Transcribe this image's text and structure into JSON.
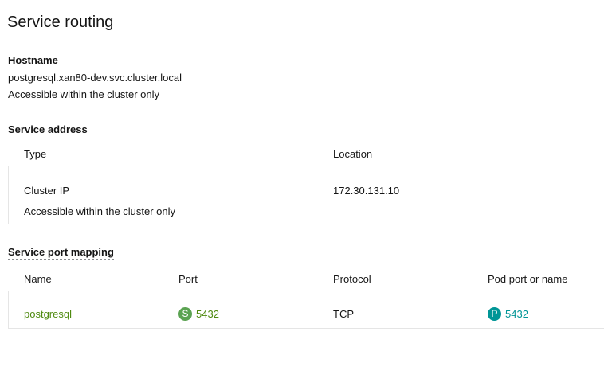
{
  "page": {
    "title": "Service routing"
  },
  "hostname": {
    "label": "Hostname",
    "value": "postgresql.xan80-dev.svc.cluster.local",
    "note": "Accessible within the cluster only"
  },
  "service_address": {
    "label": "Service address",
    "columns": [
      "Type",
      "Location"
    ],
    "rows": [
      {
        "type": "Cluster IP",
        "type_note": "Accessible within the cluster only",
        "location": "172.30.131.10"
      }
    ]
  },
  "port_mapping": {
    "label": "Service port mapping",
    "columns": [
      "Name",
      "Port",
      "Protocol",
      "Pod port or name"
    ],
    "rows": [
      {
        "name": "postgresql",
        "port_badge": "S",
        "port": "5432",
        "protocol": "TCP",
        "pod_badge": "P",
        "pod_port": "5432"
      }
    ]
  },
  "colors": {
    "link_green": "#4f8a10",
    "service_badge": "#5ba352",
    "pod_badge": "#009596",
    "divider": "#e5e5e5"
  }
}
